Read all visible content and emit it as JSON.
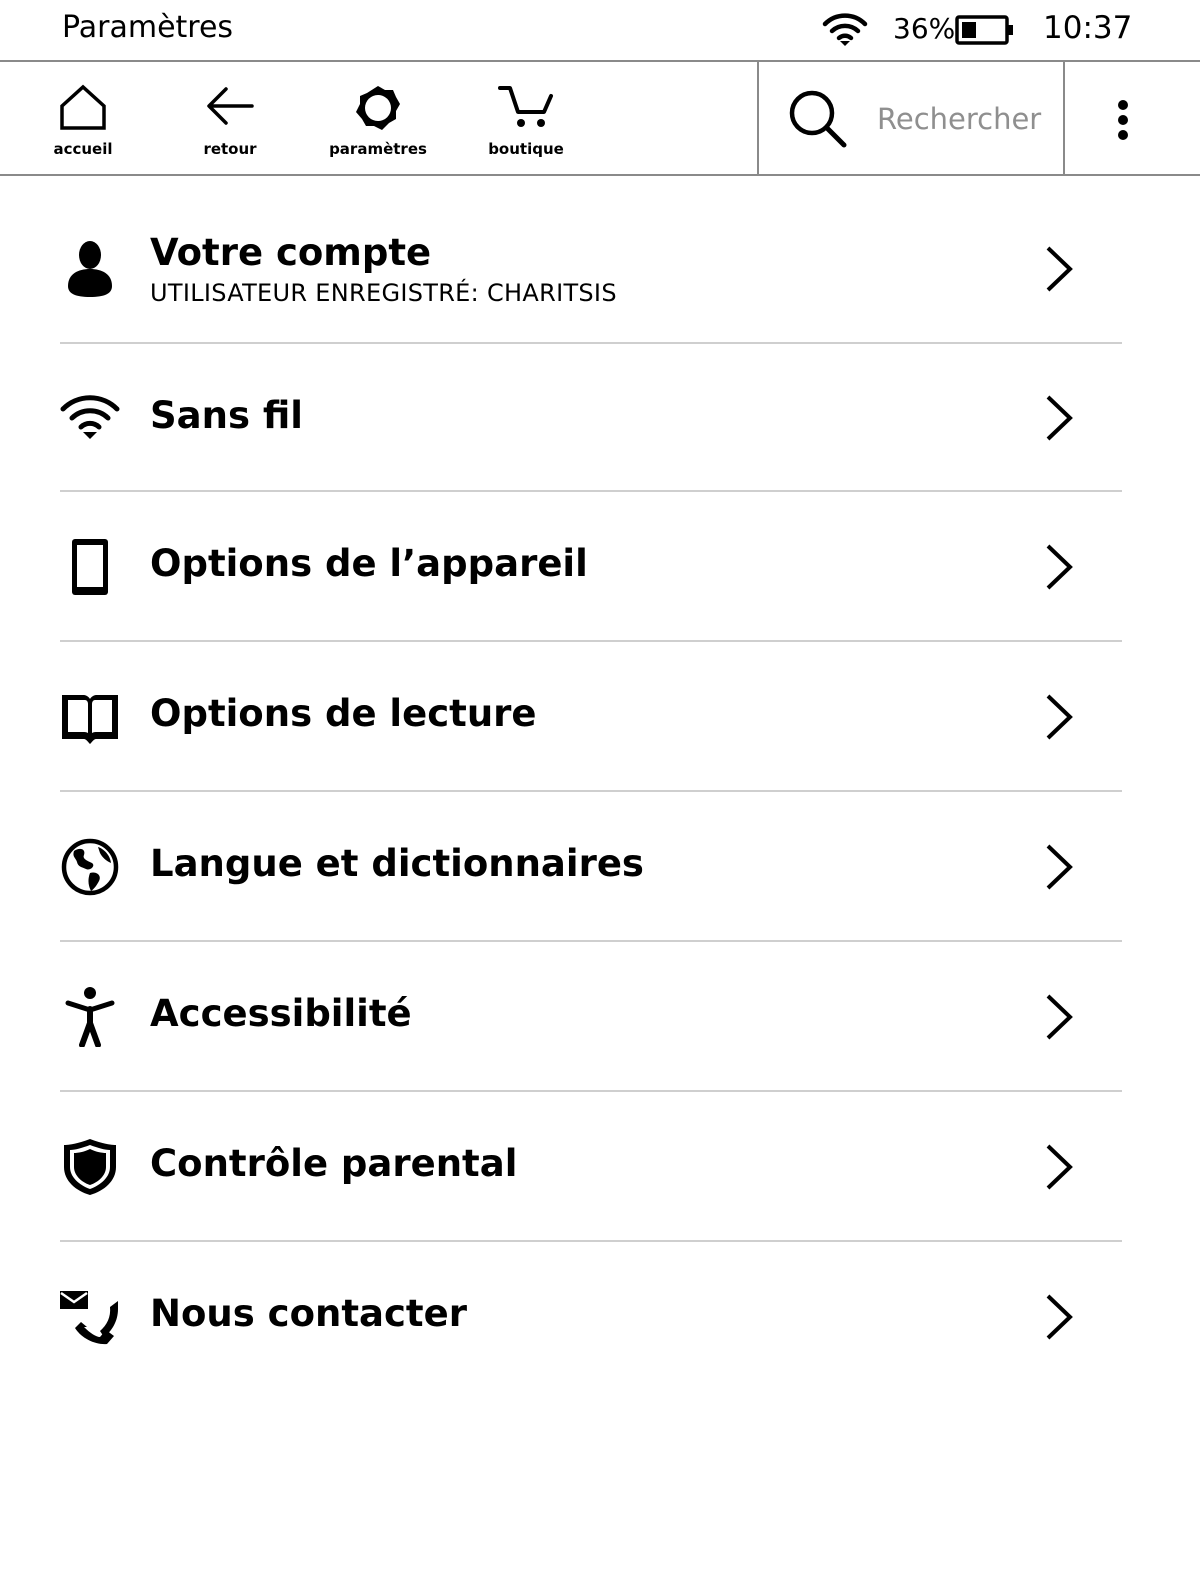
{
  "status_bar": {
    "title": "Paramètres",
    "battery_percent": "36%",
    "battery_level": 0.36,
    "time": "10:37",
    "wifi_icon": "wifi-icon",
    "battery_icon": "battery-icon"
  },
  "toolbar": {
    "buttons": [
      {
        "label": "accueil",
        "icon": "home-icon"
      },
      {
        "label": "retour",
        "icon": "back-arrow-icon"
      },
      {
        "label": "paramètres",
        "icon": "gear-icon"
      },
      {
        "label": "boutique",
        "icon": "cart-icon"
      }
    ],
    "search": {
      "placeholder": "Rechercher",
      "icon": "search-icon"
    },
    "menu_icon": "more-vertical-icon"
  },
  "settings": {
    "items": [
      {
        "label": "Votre compte",
        "sublabel": "UTILISATEUR ENREGISTRÉ: CHARITSIS",
        "icon": "person-icon"
      },
      {
        "label": "Sans fil",
        "icon": "wifi-icon"
      },
      {
        "label": "Options de l’appareil",
        "icon": "device-icon"
      },
      {
        "label": "Options de lecture",
        "icon": "book-icon"
      },
      {
        "label": "Langue et dictionnaires",
        "icon": "globe-icon"
      },
      {
        "label": "Accessibilité",
        "icon": "accessibility-icon"
      },
      {
        "label": "Contrôle parental",
        "icon": "shield-icon"
      },
      {
        "label": "Nous contacter",
        "icon": "contact-icon"
      }
    ]
  }
}
